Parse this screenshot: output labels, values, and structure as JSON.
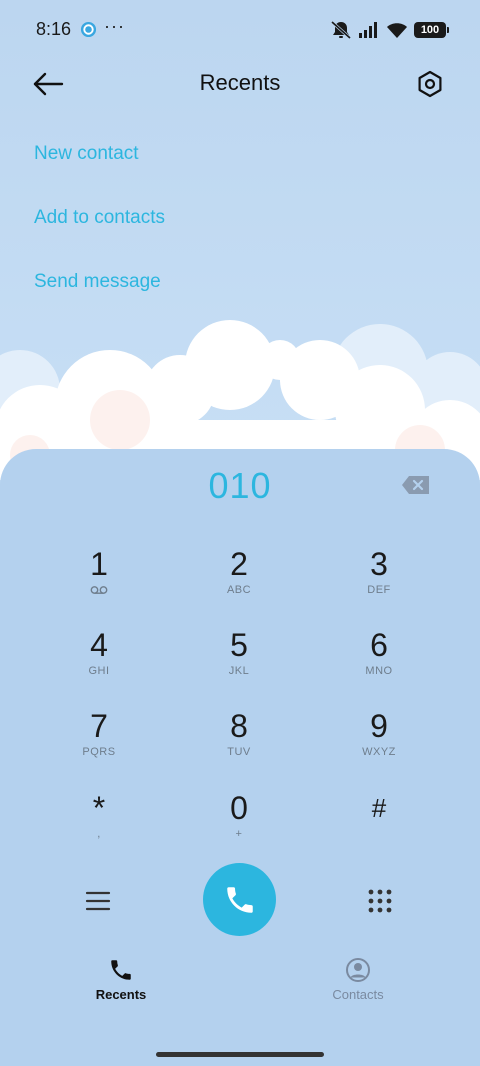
{
  "status_bar": {
    "time": "8:16",
    "more": "···",
    "battery": "100",
    "icons": [
      "app-notification-icon",
      "mute-icon",
      "signal-icon",
      "wifi-icon",
      "battery-icon"
    ]
  },
  "header": {
    "title": "Recents",
    "back_icon": "back-arrow-icon",
    "settings_icon": "settings-icon"
  },
  "actions": {
    "new_contact": "New contact",
    "add_to_contacts": "Add to contacts",
    "send_message": "Send message"
  },
  "dialer": {
    "number": "010",
    "keys": [
      {
        "digit": "1",
        "letters": ""
      },
      {
        "digit": "2",
        "letters": "ABC"
      },
      {
        "digit": "3",
        "letters": "DEF"
      },
      {
        "digit": "4",
        "letters": "GHI"
      },
      {
        "digit": "5",
        "letters": "JKL"
      },
      {
        "digit": "6",
        "letters": "MNO"
      },
      {
        "digit": "7",
        "letters": "PQRS"
      },
      {
        "digit": "8",
        "letters": "TUV"
      },
      {
        "digit": "9",
        "letters": "WXYZ"
      },
      {
        "digit": "*",
        "letters": ","
      },
      {
        "digit": "0",
        "letters": "+"
      },
      {
        "digit": "#",
        "letters": ""
      }
    ]
  },
  "nav": {
    "recents": "Recents",
    "contacts": "Contacts"
  },
  "colors": {
    "accent": "#2cb6df",
    "background": "#bcd6f0",
    "dialer_panel": "#b4d1ee"
  }
}
